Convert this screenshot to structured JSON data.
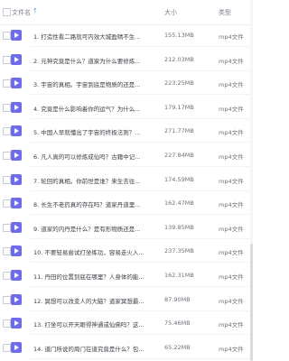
{
  "header": {
    "name": "文件名",
    "sort_icon": "sort-up-arrow",
    "size": "大小",
    "type": "类型"
  },
  "rows": [
    {
      "name": "1. 打造性看二路就可内效大城盈晴不生...",
      "size": "155.13MB",
      "type": "mp4文件"
    },
    {
      "name": "2. 元神究竟是什么？道家为什么要修炼...",
      "size": "212.03MB",
      "type": "mp4文件"
    },
    {
      "name": "3. 宇宙的真相。宇宙到底是物质的还是...",
      "size": "223.25MB",
      "type": "mp4文件"
    },
    {
      "name": "4. 究竟是什么影响着你的运气？为什么...",
      "size": "179.17MB",
      "type": "mp4文件"
    },
    {
      "name": "5. 中国人早就懂出了宇宙的终极法则？...",
      "size": "271.77MB",
      "type": "mp4文件"
    },
    {
      "name": "6. 凡人真的可以修炼成仙吗？古籍中记...",
      "size": "227.84MB",
      "type": "mp4文件"
    },
    {
      "name": "7. 轮回的真相。你前世是谁？来生去往...",
      "size": "174.59MB",
      "type": "mp4文件"
    },
    {
      "name": "8. 长生不老药真的存在吗？道家丹道里...",
      "size": "162.47MB",
      "type": "mp4文件"
    },
    {
      "name": "9. 道家的内丹是什么？是有形物质还是...",
      "size": "139.85MB",
      "type": "mp4文件"
    },
    {
      "name": "10. 不要轻易尝试打坐练功，容易走火入...",
      "size": "237.35MB",
      "type": "mp4文件"
    },
    {
      "name": "11. 丹田的位置到底在哪里？人身体的能...",
      "size": "162.31MB",
      "type": "mp4文件"
    },
    {
      "name": "12. 冥想可以改变人的大脑？道家冥想最...",
      "size": "87.90MB",
      "type": "mp4文件"
    },
    {
      "name": "13. 打坐可以开天眼得神通或仙佛吗？这...",
      "size": "75.46MB",
      "type": "mp4文件"
    },
    {
      "name": "14. 道门所说的周门在道究竟是什么？包...",
      "size": "65.22MB",
      "type": "mp4文件"
    }
  ]
}
